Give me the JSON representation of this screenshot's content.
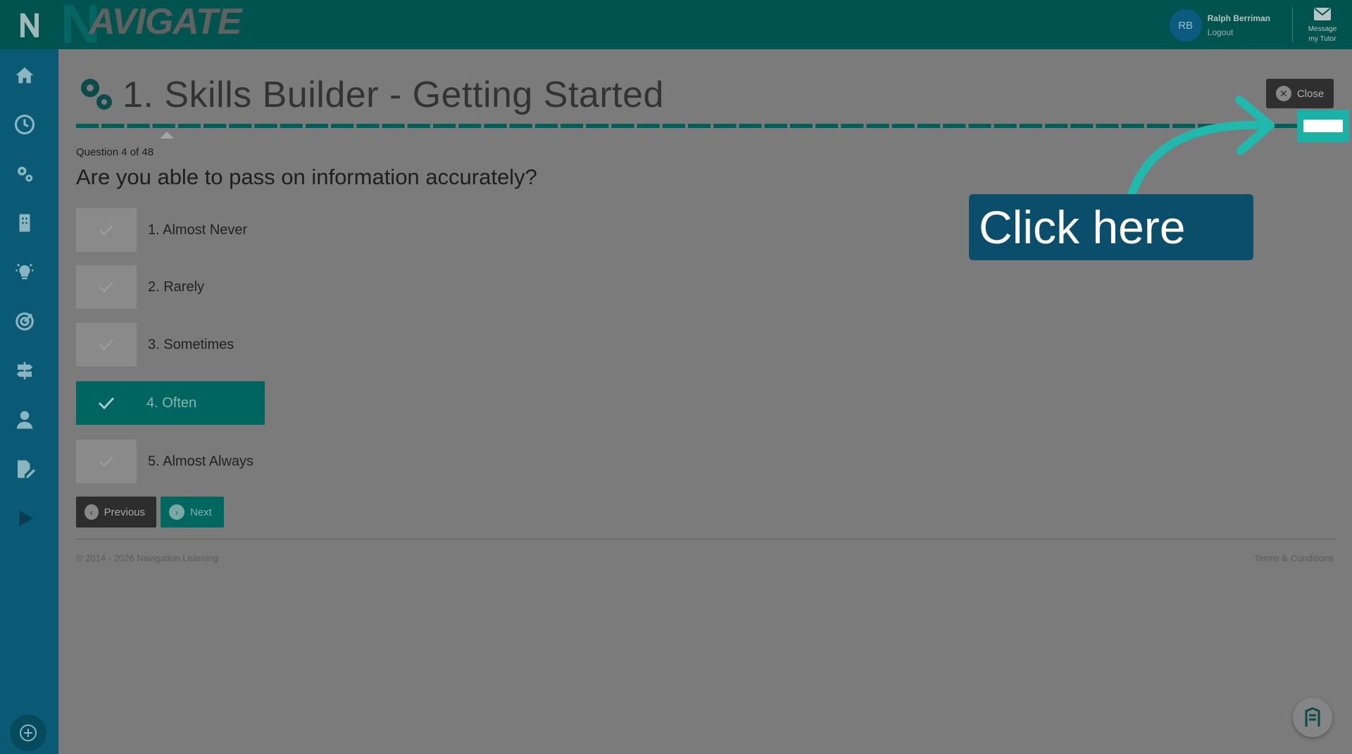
{
  "header": {
    "brand": "AVIGATE",
    "brand_initial": "N",
    "user": {
      "initials": "RB",
      "name": "Ralph Berriman",
      "logout": "Logout"
    },
    "message": {
      "line1": "Message",
      "line2": "my Tutor"
    }
  },
  "sidebar": {
    "items": [
      "home-icon",
      "clock-icon",
      "gears-icon",
      "building-icon",
      "lightbulb-icon",
      "target-icon",
      "signpost-icon",
      "user-icon",
      "edit-document-icon",
      "play-icon"
    ],
    "bottom_icon": "plus-icon"
  },
  "page": {
    "title": "1. Skills Builder - Getting Started",
    "close_label": "Close",
    "progress": {
      "current": 4,
      "total": 48
    },
    "question_count": "Question 4 of 48",
    "question": "Are you able to pass on information accurately?",
    "options": [
      {
        "label": "1. Almost Never",
        "selected": false
      },
      {
        "label": "2. Rarely",
        "selected": false
      },
      {
        "label": "3. Sometimes",
        "selected": false
      },
      {
        "label": "4. Often",
        "selected": true
      },
      {
        "label": "5. Almost Always",
        "selected": false
      }
    ],
    "previous_label": "Previous",
    "next_label": "Next"
  },
  "footer": {
    "copyright": "© 2014 - 2026 Navigation Learning",
    "terms": "Terms & Conditions"
  },
  "overlay": {
    "callout_text": "Click here"
  },
  "colors": {
    "brand_teal": "#00534f",
    "sidebar": "#0b5a75",
    "accent": "#00655f",
    "callout": "#0b4e6b",
    "hotspot": "#1ab2a7"
  }
}
